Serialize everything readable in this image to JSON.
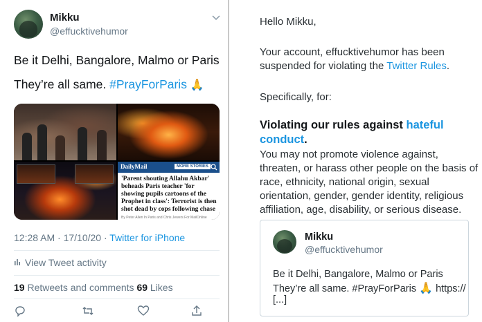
{
  "tweet": {
    "name": "Mikku",
    "handle": "@effucktivehumor",
    "text_line1": "Be it Delhi, Bangalore, Malmo or Paris",
    "text_line2_prefix": "They’re all same. ",
    "hashtag": "#PrayForParis",
    "emoji": "🙏",
    "media": {
      "news_logo": "DailyMail",
      "more_stories": "MORE STORIES",
      "headline": "'Parent shouting Allahu Akbar' beheads Paris teacher 'for showing pupils cartoons of the Prophet in class': Terrorist is then shot dead by cops following chase",
      "byline": "By Peter Allen In Paris and Chris Jewers For MailOnline"
    },
    "timestamp": "12:28 AM · 17/10/20 · ",
    "source": "Twitter for iPhone",
    "activity": "View Tweet activity",
    "retweets_count": "19",
    "retweets_label": " Retweets and comments ",
    "likes_count": "69",
    "likes_label": " Likes"
  },
  "email": {
    "greeting": "Hello Mikku,",
    "p1_line1": "Your account, effucktivehumor has been",
    "p1_line2_prefix": "suspended for violating the ",
    "p1_link": "Twitter Rules",
    "p1_suffix": ".",
    "specifically": "Specifically, for:",
    "heading_prefix": "Violating our rules against ",
    "heading_link_1": "hateful",
    "heading_link_2": "conduct",
    "heading_suffix": ".",
    "body": "You may not promote violence against, threaten, or harass other people on the basis of race, ethnicity, national origin, sexual orientation, gender, gender identity, religious affiliation, age, disability, or serious disease.",
    "quote": {
      "name": "Mikku",
      "handle": "@effucktivehumor",
      "line1": "Be it Delhi, Bangalore, Malmo or Paris",
      "line2_prefix": "They’re all same. #PrayForParis ",
      "line2_suffix": " https://",
      "line3": "[...]"
    }
  },
  "colors": {
    "link": "#1b95e0",
    "secondary_text": "#657786",
    "primary_text": "#14171a",
    "dailymail_blue": "#1a4f8b"
  },
  "icons": [
    "chevron-down-icon",
    "bar-chart-icon",
    "reply-icon",
    "retweet-icon",
    "like-icon",
    "share-icon",
    "search-icon",
    "pray-emoji"
  ]
}
